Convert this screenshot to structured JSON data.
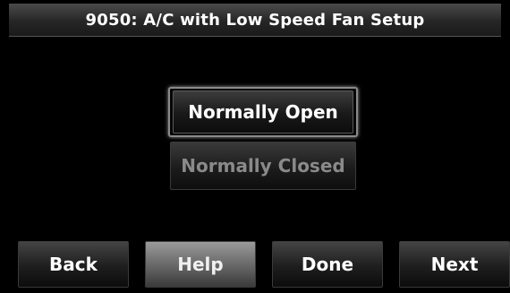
{
  "header": {
    "title": "9050: A/C with Low Speed Fan Setup"
  },
  "options": {
    "normally_open_label": "Normally Open",
    "normally_closed_label": "Normally Closed",
    "selected": "Normally Open"
  },
  "footer": {
    "back_label": "Back",
    "help_label": "Help",
    "done_label": "Done",
    "next_label": "Next"
  }
}
